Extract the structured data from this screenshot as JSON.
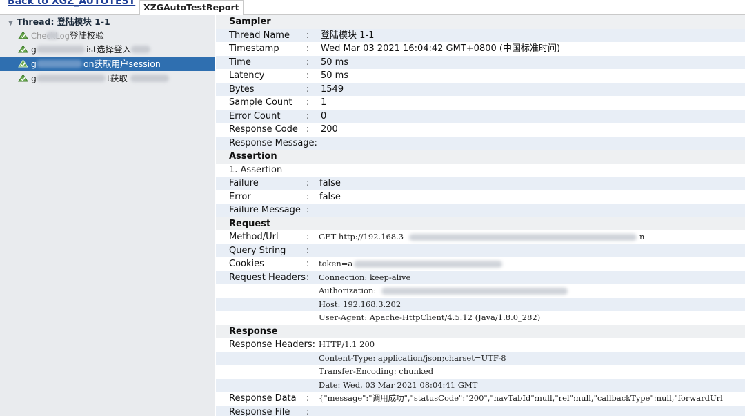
{
  "header": {
    "back_link": "Back to XGZ_AUTOTEST",
    "report_tab": "XZGAutoTestReport"
  },
  "tree": {
    "thread_label": "Thread: 登陆模块 1-1",
    "items": [
      {
        "prefix": "CheckLog",
        "label": "登陆校验",
        "selected": false
      },
      {
        "prefix": "g",
        "label": "ist选择登入",
        "selected": false
      },
      {
        "prefix": "g",
        "label": "on获取用户session",
        "selected": true
      },
      {
        "prefix": "g",
        "label": "t获取",
        "selected": false
      }
    ],
    "icon": "success-triangle-icon",
    "selected_color": "#2f6fb0"
  },
  "detail": {
    "sampler": {
      "heading": "Sampler",
      "rows": [
        {
          "key": "Thread Name",
          "value": "登陆模块 1-1"
        },
        {
          "key": "Timestamp",
          "value": "Wed Mar 03 2021 16:04:42 GMT+0800 (中国标准时间)"
        },
        {
          "key": "Time",
          "value": "50 ms"
        },
        {
          "key": "Latency",
          "value": "50 ms"
        },
        {
          "key": "Bytes",
          "value": "1549"
        },
        {
          "key": "Sample Count",
          "value": "1"
        },
        {
          "key": "Error Count",
          "value": "0"
        },
        {
          "key": "Response Code",
          "value": "200"
        },
        {
          "key": "Response Message:",
          "value": ""
        }
      ]
    },
    "assertion": {
      "heading": "Assertion",
      "title": "1. Assertion",
      "rows": [
        {
          "key": "Failure",
          "value": "false"
        },
        {
          "key": "Error",
          "value": "false"
        },
        {
          "key": "Failure Message",
          "value": ""
        }
      ]
    },
    "request": {
      "heading": "Request",
      "method_url_key": "Method/Url",
      "method_url_value": "GET http://192.168.3",
      "method_url_tail": "n",
      "query_string_key": "Query String",
      "cookies_key": "Cookies",
      "cookies_value": "token=a",
      "headers_key": "Request Headers",
      "headers": [
        "Connection: keep-alive",
        "Authorization:",
        "Host: 192.168.3.202",
        "User-Agent: Apache-HttpClient/4.5.12 (Java/1.8.0_282)"
      ]
    },
    "response": {
      "heading": "Response",
      "headers_key": "Response Headers:",
      "headers": [
        "HTTP/1.1 200",
        "Content-Type: application/json;charset=UTF-8",
        "Transfer-Encoding: chunked",
        "Date: Wed, 03 Mar 2021 08:04:41 GMT"
      ],
      "data_key": "Response Data",
      "data_value": "{\"message\":\"调用成功\",\"statusCode\":\"200\",\"navTabId\":null,\"rel\":null,\"callbackType\":null,\"forwardUrl",
      "file_key": "Response File"
    },
    "colors": {
      "stripe": "#e8eef6",
      "accent": "#1f3f96"
    }
  }
}
